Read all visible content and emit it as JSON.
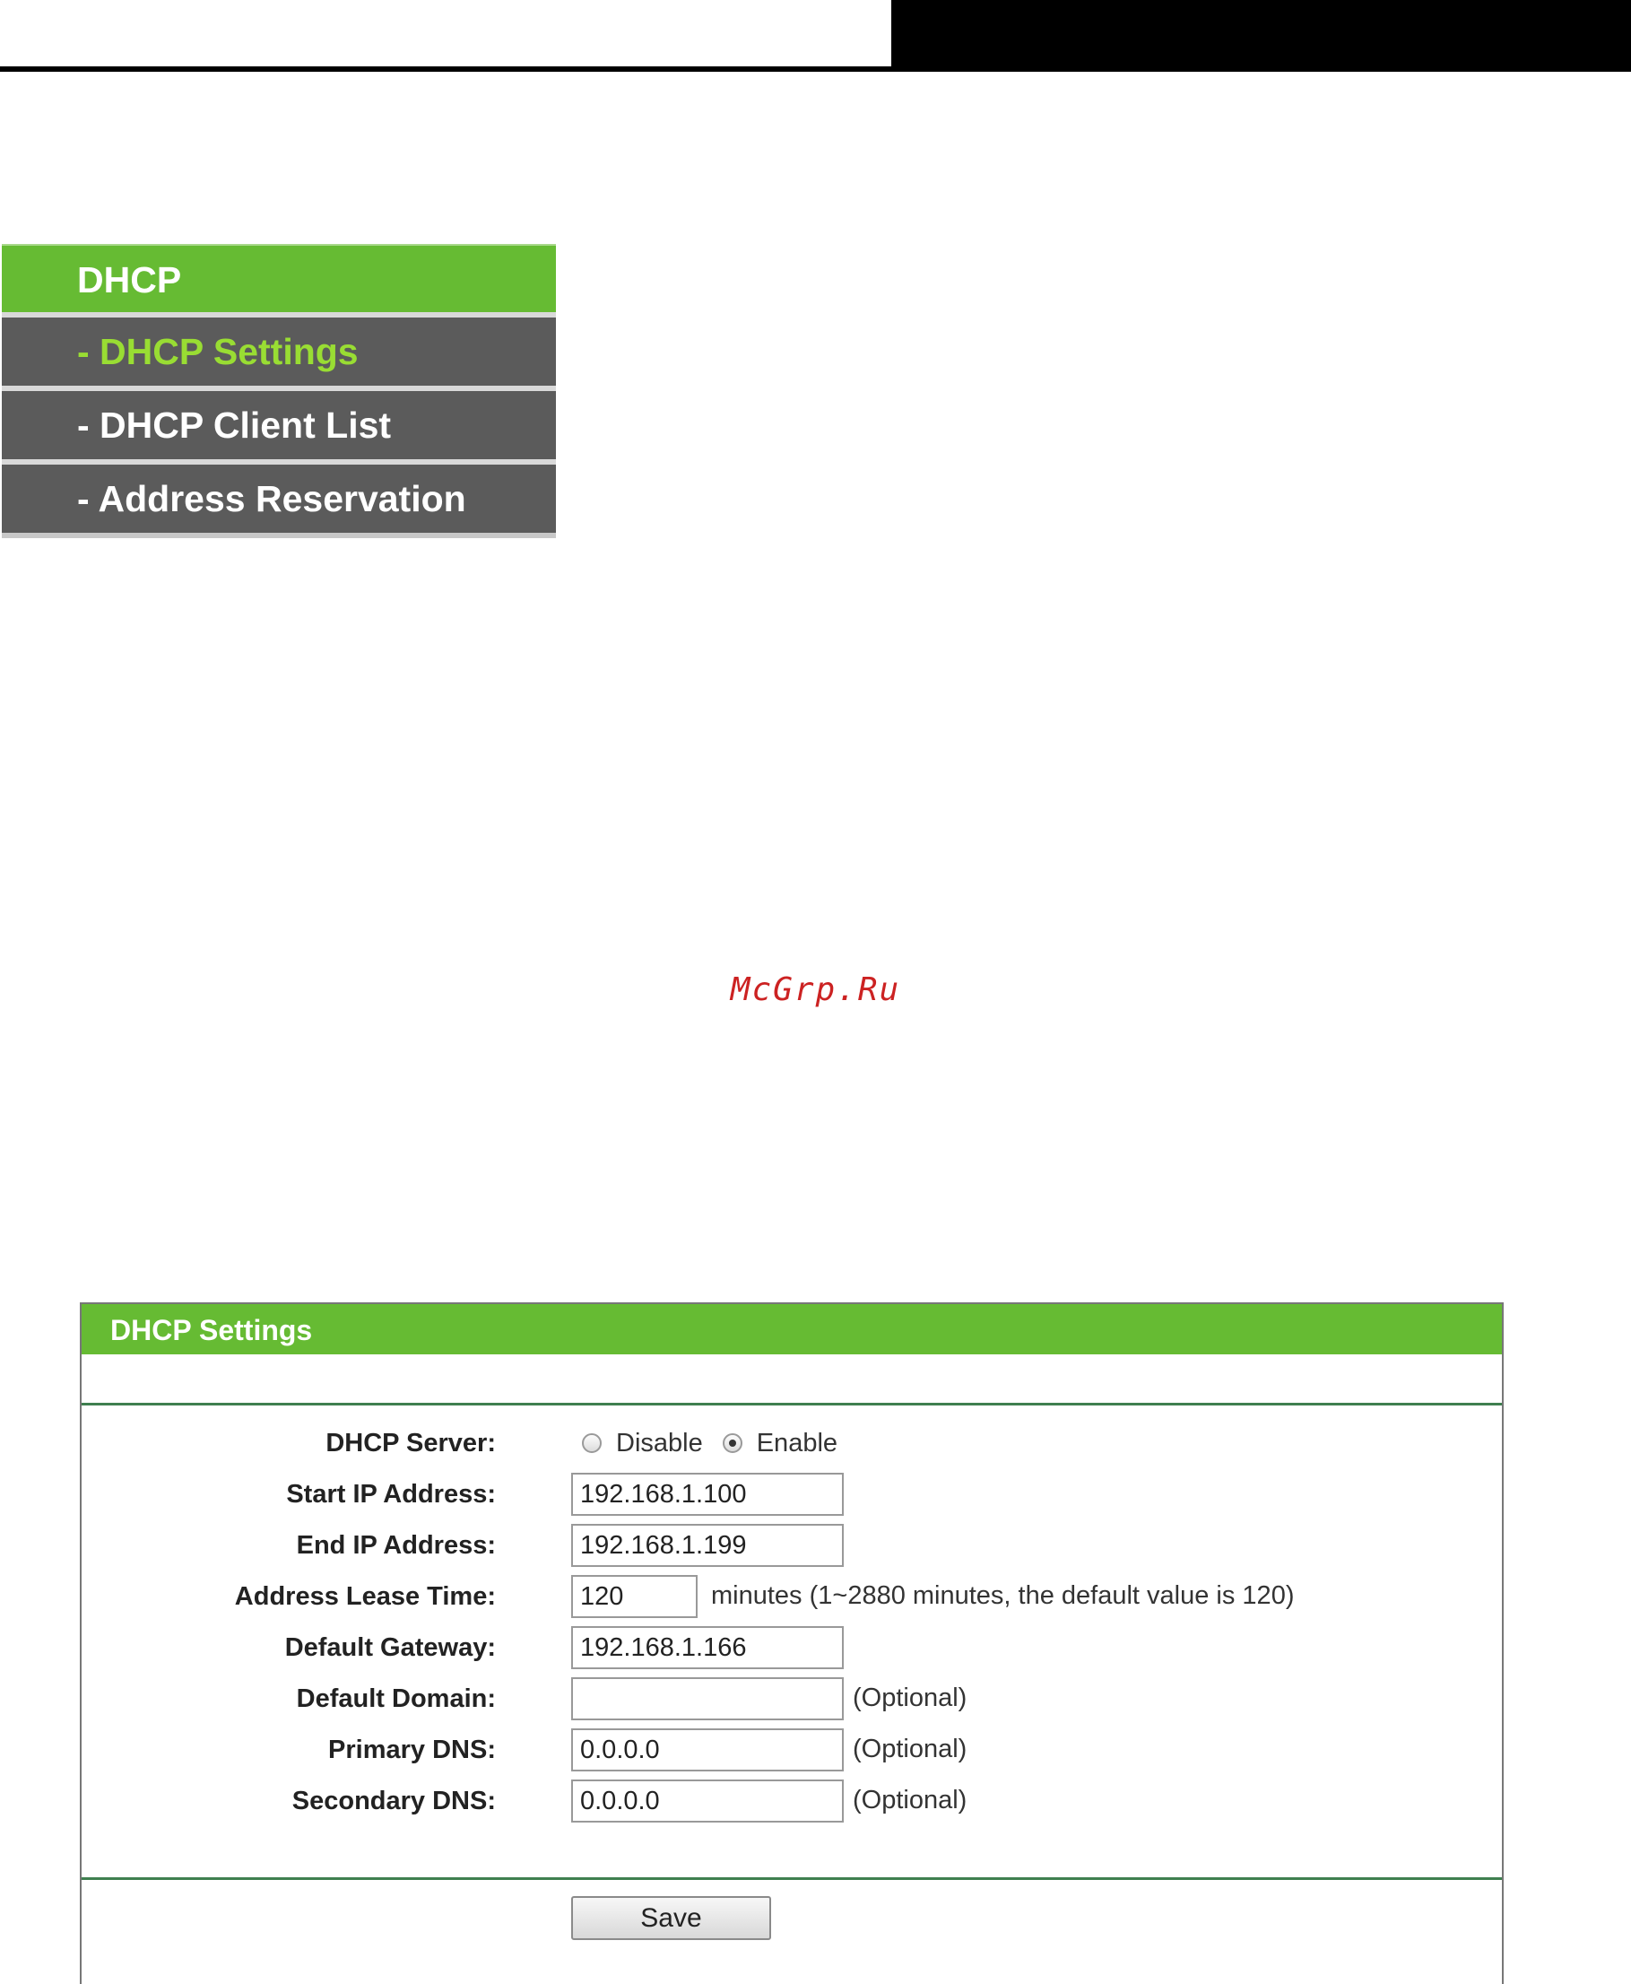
{
  "menu": {
    "header": "DHCP",
    "items": [
      {
        "label": "- DHCP Settings",
        "active": true
      },
      {
        "label": "- DHCP Client List",
        "active": false
      },
      {
        "label": "- Address Reservation",
        "active": false
      }
    ]
  },
  "watermark": "McGrp.Ru",
  "panel": {
    "title": "DHCP Settings",
    "dhcp_server": {
      "label": "DHCP Server:",
      "options": [
        "Disable",
        "Enable"
      ],
      "selected": "Enable"
    },
    "fields": {
      "start_ip": {
        "label": "Start IP Address:",
        "value": "192.168.1.100"
      },
      "end_ip": {
        "label": "End IP Address:",
        "value": "192.168.1.199"
      },
      "lease_time": {
        "label": "Address Lease Time:",
        "value": "120",
        "note": "minutes (1~2880 minutes, the default value is 120)"
      },
      "default_gateway": {
        "label": "Default Gateway:",
        "value": "192.168.1.166"
      },
      "default_domain": {
        "label": "Default Domain:",
        "value": "",
        "note": "(Optional)"
      },
      "primary_dns": {
        "label": "Primary DNS:",
        "value": "0.0.0.0",
        "note": "(Optional)"
      },
      "secondary_dns": {
        "label": "Secondary DNS:",
        "value": "0.0.0.0",
        "note": "(Optional)"
      }
    },
    "save_label": "Save"
  },
  "colors": {
    "header_green": "#66bb33",
    "menu_item_bg": "#5b5b5b",
    "active_item_text": "#99dd33",
    "rule_green": "#3f7f4f",
    "watermark_red": "#cc2222"
  }
}
